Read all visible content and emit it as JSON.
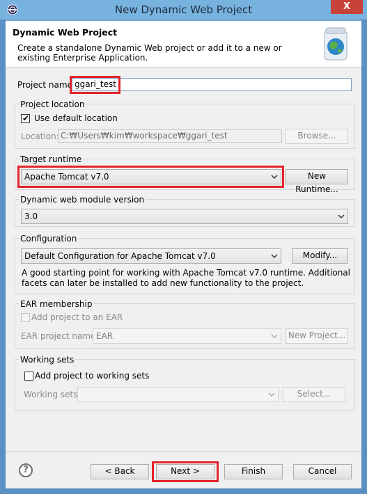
{
  "window": {
    "title": "New Dynamic Web Project",
    "close_glyph": "X"
  },
  "header": {
    "title": "Dynamic Web Project",
    "description": "Create a standalone Dynamic Web project or add it to a new or existing Enterprise Application."
  },
  "project_name": {
    "label": "Project name:",
    "value": "ggari_test"
  },
  "project_location": {
    "group_title": "Project location",
    "use_default_label": "Use default location",
    "use_default_checked": true,
    "location_label": "Location:",
    "location_value": "C:₩Users₩kim₩workspace₩ggari_test",
    "browse_label": "Browse..."
  },
  "target_runtime": {
    "group_title": "Target runtime",
    "selected": "Apache Tomcat v7.0",
    "new_runtime_label": "New Runtime..."
  },
  "module_version": {
    "group_title": "Dynamic web module version",
    "selected": "3.0"
  },
  "configuration": {
    "group_title": "Configuration",
    "selected": "Default Configuration for Apache Tomcat v7.0",
    "modify_label": "Modify...",
    "description": "A good starting point for working with Apache Tomcat v7.0 runtime. Additional facets can later be installed to add new functionality to the project."
  },
  "ear_membership": {
    "group_title": "EAR membership",
    "add_label": "Add project to an EAR",
    "project_name_label": "EAR project name:",
    "project_name_value": "EAR",
    "new_project_label": "New Project..."
  },
  "working_sets": {
    "group_title": "Working sets",
    "add_label": "Add project to working sets",
    "sets_label": "Working sets:",
    "select_label": "Select..."
  },
  "footer": {
    "help_glyph": "?",
    "back_label": "< Back",
    "next_label": "Next >",
    "finish_label": "Finish",
    "cancel_label": "Cancel"
  },
  "colors": {
    "highlight": "#e2242a",
    "title_bar": "#78b2de",
    "close": "#c7433a"
  }
}
